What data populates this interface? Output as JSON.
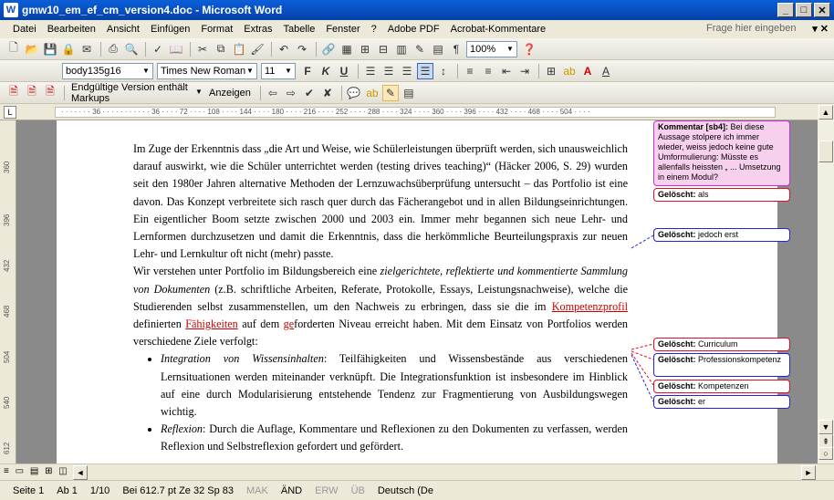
{
  "window": {
    "title": "gmw10_em_ef_cm_version4.doc - Microsoft Word"
  },
  "menu": {
    "items": [
      "Datei",
      "Bearbeiten",
      "Ansicht",
      "Einfügen",
      "Format",
      "Extras",
      "Tabelle",
      "Fenster",
      "?",
      "Adobe PDF",
      "Acrobat-Kommentare"
    ],
    "help_placeholder": "Frage hier eingeben"
  },
  "toolbar": {
    "zoom": "100%",
    "style": "body135g16",
    "font": "Times New Roman",
    "size": "11"
  },
  "review": {
    "display_mode": "Endgültige Version enthält Markups",
    "show_label": "Anzeigen"
  },
  "ruler": {
    "h_ticks": "· · · · · · · 36 · · · · · · · · · · · 36 · · · · 72 · · · · 108 · · · · 144 · · · · 180 · · · · 216 · · · · 252 · · · · 288 · · · · 324 · · · · 360 · · · · 396 · · · · 432 · · · · 468 · · · · 504 · · · ·",
    "v_ticks": [
      "360",
      "396",
      "432",
      "468",
      "504",
      "540",
      "576",
      "612"
    ]
  },
  "document": {
    "paragraph1": [
      "Im Zuge der Erkenntnis dass „die Art und Weise, wie Schülerleistungen überprüft werden, sich unausweichlich darauf auswirkt, wie die Schüler unterrichtet werden (testing drives teaching)“ (Häcker 2006, S. 29) wurden seit den 1980er Jahren alternative Methoden der Lernzuwachsüberprüfung untersucht – das Portfolio ist eine davon. Das Konzept verbreitete sich rasch quer durch das Fächerangebot und in allen Bildungseinrichtungen. Ein eigentlicher Boom setzte zwischen 2000 und 2003 ein. Immer mehr begannen sich neue Lehr- und Lernformen durchzusetzen und damit die Erkenntnis, dass die herkömmliche Beurteilungspraxis zur neuen Lehr- und Lernkultur oft nicht (mehr) passte."
    ],
    "p2_start": "Wir verstehen unter Portfolio im Bildungsbereich eine ",
    "p2_italic": "zielgerichtete, reflektierte und kommentierte Sammlung von Dokumenten",
    "p2_mid": " (z.B. schriftliche Arbeiten, Referate, Protokolle, Essays, Leistungsnachweise), welche die Studierenden selbst zusammenstellen, um den Nachweis zu erbringen, dass sie die im ",
    "p2_ins1": "Kompetenzprofil",
    "p2_mid2": " definierten ",
    "p2_ins2": "Fähigkeiten",
    "p2_mid3": " auf dem ",
    "p2_ins3": "ge",
    "p2_end": "forderten Niveau erreicht haben. Mit dem Einsatz von Portfolios werden verschiedene Ziele verfolgt:",
    "bullet1_italic": "Integration von Wissensinhalten",
    "bullet1_text": ": Teilfähigkeiten und Wissensbestände aus verschiedenen Lernsituationen werden miteinander verknüpft. Die Integrationsfunktion ist insbesondere im Hinblick auf eine durch Modularisierung entstehende Tendenz zur Fragmentierung von Ausbildungswegen wichtig.",
    "bullet2_italic": "Reflexion",
    "bullet2_text": ": Durch die Auflage, Kommentare und Reflexionen zu den Dokumenten zu verfassen, werden Reflexion und Selbstreflexion gefordert und gefördert."
  },
  "balloons": [
    {
      "label": "Kommentar [sb4]:",
      "text": " Bei diese Aussage stolpere ich immer wieder, weiss jedoch keine gute Umformulierung: Müsste es allenfalls heissten „ ... Umsetzung in einem Modul?"
    },
    {
      "label": "Gelöscht:",
      "text": " als"
    },
    {
      "label": "Gelöscht:",
      "text": " jedoch erst"
    },
    {
      "label": "Gelöscht:",
      "text": " Curriculum"
    },
    {
      "label": "Gelöscht:",
      "text": " Professionskompetenz"
    },
    {
      "label": "Gelöscht:",
      "text": " Kompetenzen"
    },
    {
      "label": "Gelöscht:",
      "text": " er"
    }
  ],
  "status": {
    "page": "Seite 1",
    "section": "Ab 1",
    "pages": "1/10",
    "position": "Bei 612.7 pt Ze 32  Sp 83",
    "mak": "MAK",
    "aend": "ÄND",
    "erw": "ERW",
    "ueb": "ÜB",
    "language": "Deutsch (De"
  }
}
